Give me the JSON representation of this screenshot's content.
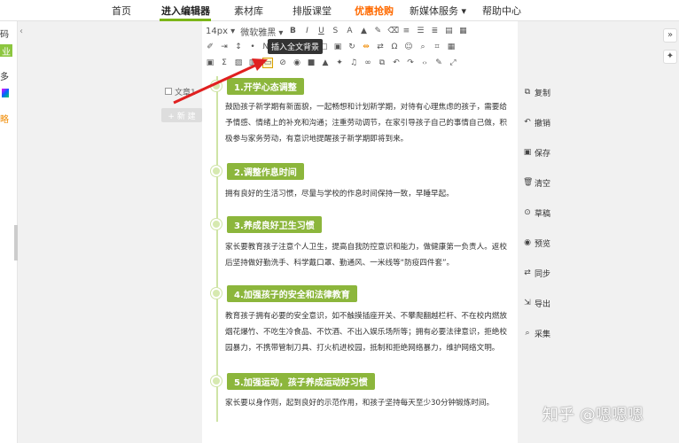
{
  "nav": {
    "items": [
      "首页",
      "进入编辑器",
      "素材库",
      "排版课堂",
      "优惠抢购",
      "新媒体服务 ▾",
      "帮助中心"
    ]
  },
  "left": {
    "t1": "码",
    "t2": "业",
    "t3": "多",
    "t4": "略"
  },
  "article_list": {
    "item": "文章1",
    "new_button": "+ 新 建"
  },
  "toolbar": {
    "font_size": "14px ▾",
    "font_family": "微软雅黑 ▾",
    "tooltip": "插入全文背景"
  },
  "sections": [
    {
      "title": "1.开学心态调整",
      "text": "鼓励孩子新学期有新面貌，一起畅想和计划新学期，对待有心理焦虑的孩子，需要给予情感、情绪上的补充和沟通；注重劳动调节，在家引导孩子自己的事情自己做，积极参与家务劳动，有意识地提醒孩子新学期即将到来。"
    },
    {
      "title": "2.调整作息时间",
      "text": "拥有良好的生活习惯，尽量与学校的作息时间保持一致，早睡早起。"
    },
    {
      "title": "3.养成良好卫生习惯",
      "text": "家长要教育孩子注意个人卫生，提高自我防控意识和能力，做健康第一负责人。返校后坚持做好勤洗手、科学戴口罩、勤通风、一米线等“防疫四件套”。"
    },
    {
      "title": "4.加强孩子的安全和法律教育",
      "text": "教育孩子拥有必要的安全意识，如不触摸插座开关、不攀爬翻越栏杆、不在校内燃放烟花爆竹、不吃生冷食品、不饮酒、不出入娱乐场所等；拥有必要法律意识，拒绝校园暴力，不携带管制刀具、打火机进校园，抵制和拒绝网络暴力，维护网络文明。"
    },
    {
      "title": "5.加强运动，孩子养成运动好习惯",
      "text": "家长要以身作则，起到良好的示范作用，和孩子坚持每天至少30分钟锻炼时间。"
    }
  ],
  "tools": [
    "复制",
    "撤销",
    "保存",
    "清空",
    "草稿",
    "预览",
    "同步",
    "导出",
    "采集"
  ],
  "watermark": "知乎 @嗯嗯嗯",
  "colors": {
    "accent": "#8cb63c",
    "promo": "#ff6a00",
    "arrow": "#e02020"
  }
}
